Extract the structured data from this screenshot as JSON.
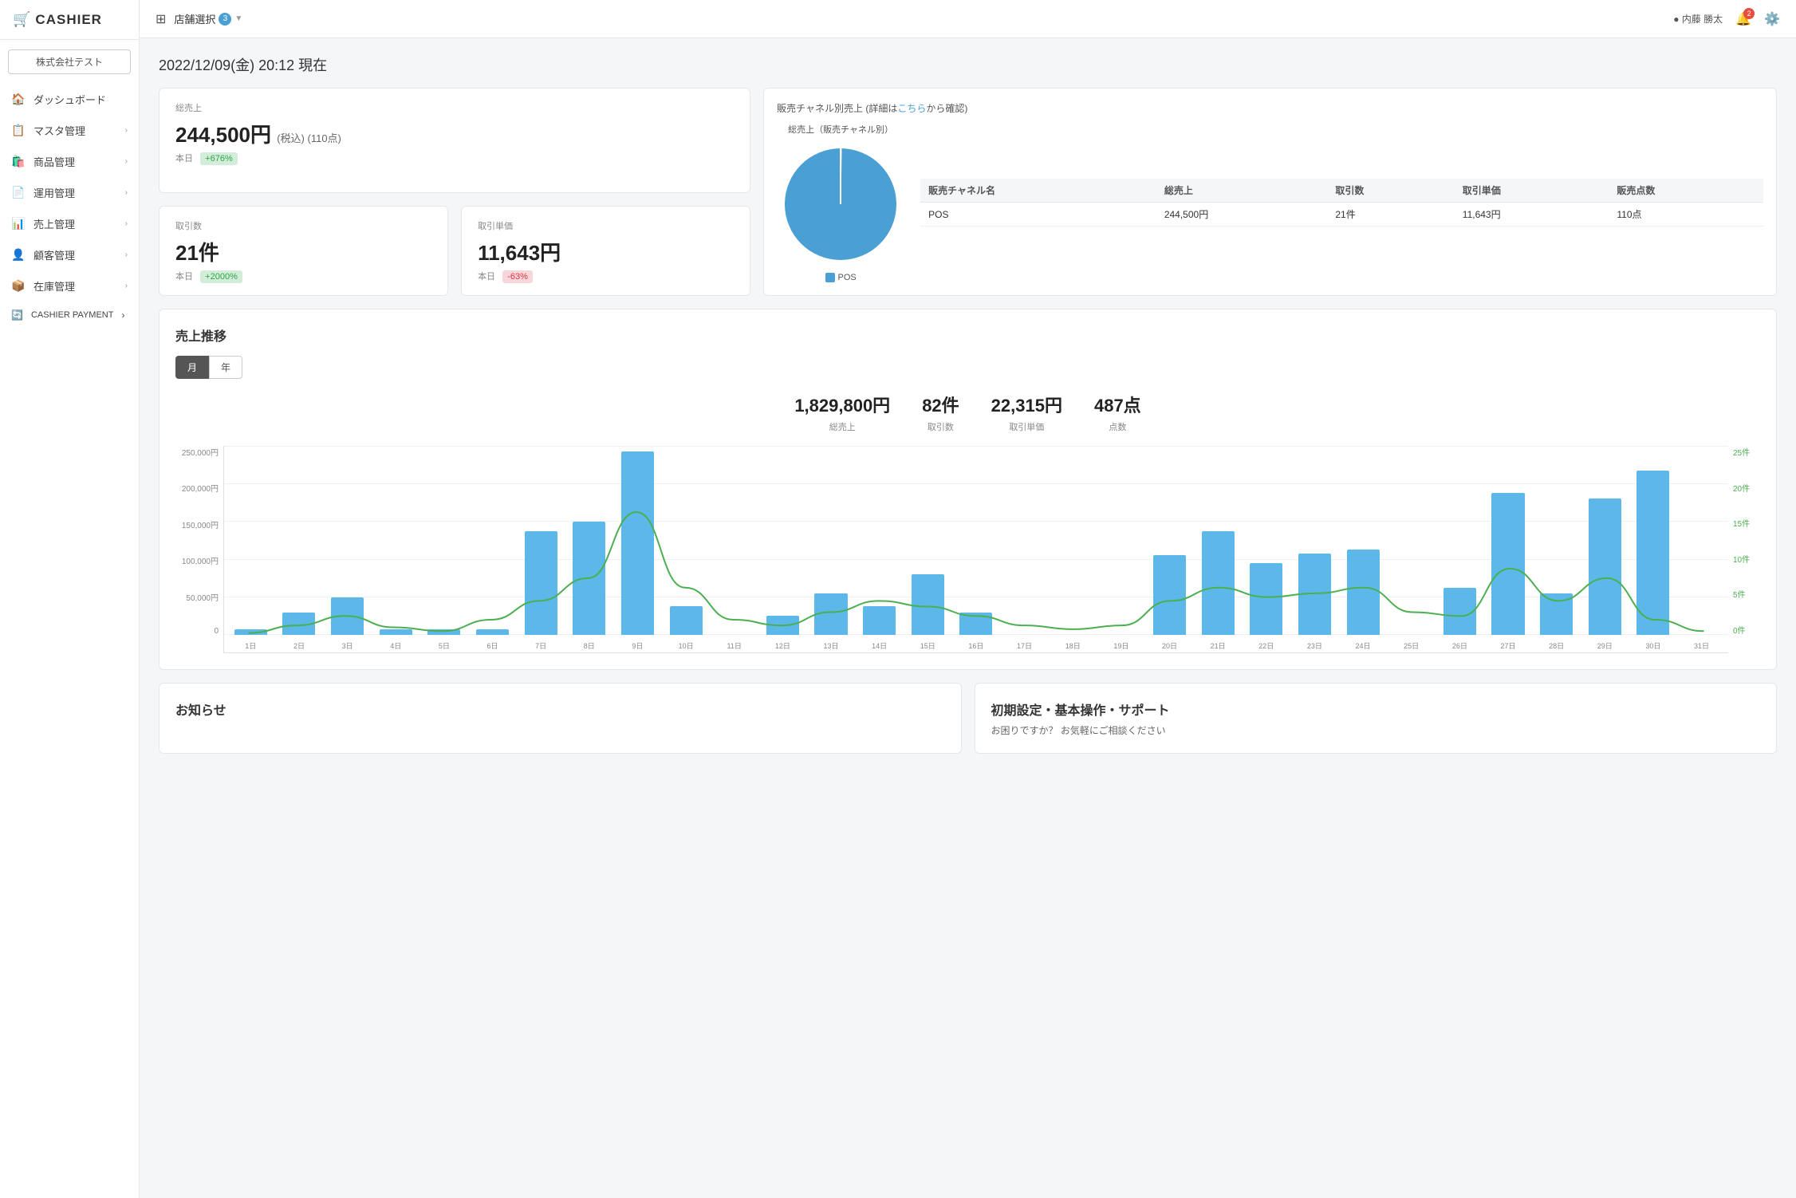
{
  "sidebar": {
    "logo": "CASHIER",
    "company_btn": "株式会社テスト",
    "items": [
      {
        "id": "dashboard",
        "label": "ダッシュボード",
        "icon": "🏠",
        "has_arrow": false
      },
      {
        "id": "master",
        "label": "マスタ管理",
        "icon": "📋",
        "has_arrow": true
      },
      {
        "id": "products",
        "label": "商品管理",
        "icon": "🛍️",
        "has_arrow": true
      },
      {
        "id": "operations",
        "label": "運用管理",
        "icon": "📄",
        "has_arrow": true
      },
      {
        "id": "sales",
        "label": "売上管理",
        "icon": "📊",
        "has_arrow": true
      },
      {
        "id": "customers",
        "label": "顧客管理",
        "icon": "👤",
        "has_arrow": true
      },
      {
        "id": "inventory",
        "label": "在庫管理",
        "icon": "📦",
        "has_arrow": true
      },
      {
        "id": "cashier_payment",
        "label": "CASHIER PAYMENT",
        "icon": "🔄",
        "has_arrow": true
      }
    ]
  },
  "header": {
    "store_label": "店舗選択",
    "store_badge": "3",
    "user_dot": "● 内藤 勝太",
    "notif_badge": "2"
  },
  "main": {
    "datetime": "2022/12/09(金) 20:12 現在",
    "total_sales": {
      "label": "総売上",
      "value": "244,500円",
      "suffix": "(税込) (110点)",
      "today_label": "本日",
      "today_value": "+676%",
      "badge_type": "green"
    },
    "transactions": {
      "label": "取引数",
      "value": "21件",
      "today_label": "本日",
      "today_value": "+2000%",
      "badge_type": "green"
    },
    "avg_price": {
      "label": "取引単価",
      "value": "11,643円",
      "today_label": "本日",
      "today_value": "-63%",
      "badge_type": "red"
    },
    "pie_section": {
      "title": "販売チャネル別売上 (詳細は",
      "link_text": "こちら",
      "title_suffix": "から確認)",
      "pie_label": "総売上（販売チャネル別）",
      "legend": "POS",
      "table": {
        "headers": [
          "販売チャネル名",
          "総売上",
          "取引数",
          "取引単価",
          "販売点数"
        ],
        "rows": [
          [
            "POS",
            "244,500円",
            "21件",
            "11,643円",
            "110点"
          ]
        ]
      }
    },
    "trend": {
      "title": "売上推移",
      "tab_month": "月",
      "tab_year": "年",
      "summary": {
        "total_sales_value": "1,829,800円",
        "total_sales_label": "総売上",
        "txn_value": "82件",
        "txn_label": "取引数",
        "avg_value": "22,315円",
        "avg_label": "取引単価",
        "points_value": "487点",
        "points_label": "点数"
      },
      "y_left": [
        "250,000円",
        "200,000円",
        "150,000円",
        "100,000円",
        "50,000円",
        "0"
      ],
      "y_right": [
        "25件",
        "20件",
        "15件",
        "10件",
        "5件",
        "0件"
      ],
      "x_labels": [
        "1日",
        "2日",
        "3日",
        "4日",
        "5日",
        "6日",
        "7日",
        "8日",
        "9日",
        "10日",
        "11日",
        "12日",
        "13日",
        "14日",
        "15日",
        "16日",
        "17日",
        "18日",
        "19日",
        "20日",
        "21日",
        "22日",
        "23日",
        "24日",
        "25日",
        "26日",
        "27日",
        "28日",
        "29日",
        "30日",
        "31日"
      ],
      "bar_heights_pct": [
        3,
        12,
        20,
        3,
        3,
        3,
        55,
        60,
        97,
        15,
        0,
        10,
        22,
        15,
        32,
        12,
        0,
        0,
        0,
        42,
        55,
        38,
        43,
        45,
        0,
        25,
        75,
        22,
        72,
        87,
        0
      ],
      "line_vals_pct": [
        1,
        5,
        10,
        4,
        2,
        8,
        18,
        30,
        65,
        25,
        8,
        5,
        12,
        18,
        15,
        10,
        5,
        3,
        5,
        18,
        25,
        20,
        22,
        25,
        12,
        10,
        35,
        18,
        30,
        8,
        2
      ]
    },
    "notices": {
      "title": "お知らせ"
    },
    "support": {
      "title": "初期設定・基本操作・サポート",
      "subtitle": "お困りですか？ お気軽にご相談ください"
    }
  }
}
